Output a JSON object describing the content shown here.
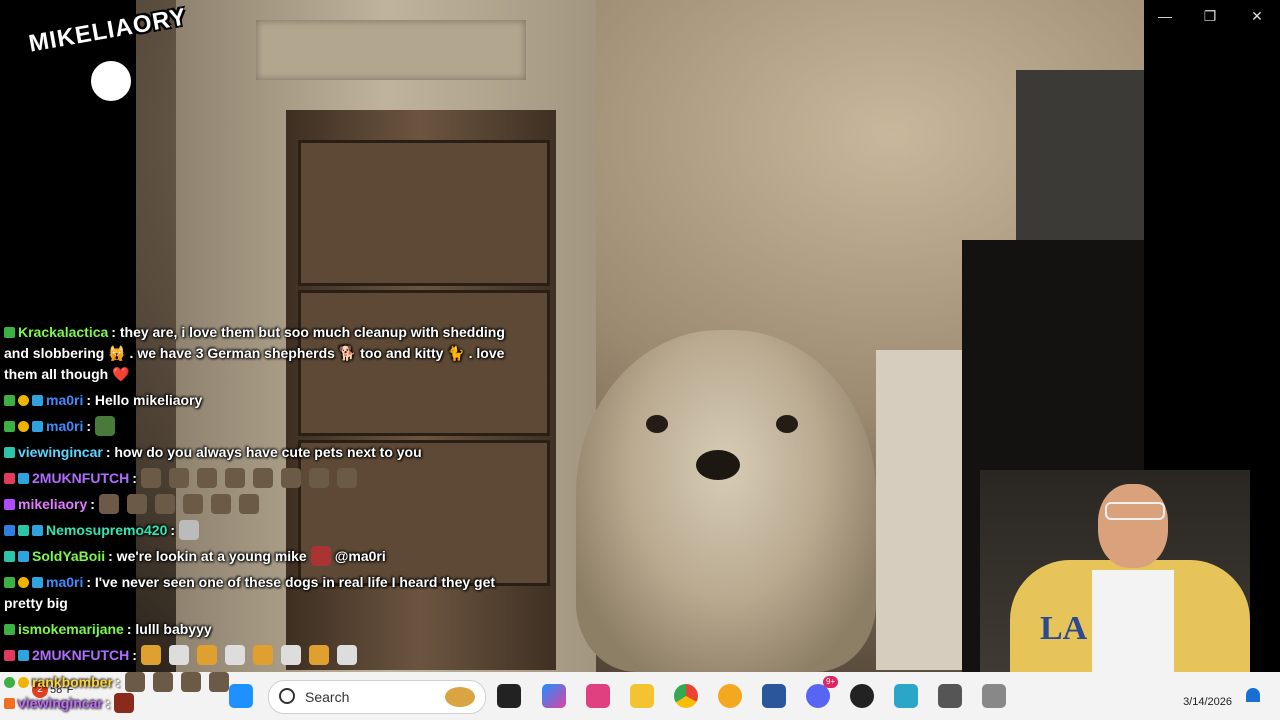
{
  "logo": {
    "text": "MIKELIAORY"
  },
  "window_controls": {
    "minimize": "—",
    "restore": "❐",
    "close": "✕"
  },
  "chat": {
    "messages": [
      {
        "user": "Krackalactica",
        "user_color": "#7cf84a",
        "text": ": they are, i love them but soo much cleanup with shedding and slobbering 🙀 . we have 3 German shepherds 🐕 too and kitty 🐈 . love them all though ❤️"
      },
      {
        "user": "ma0ri",
        "user_color": "#3b8dff",
        "text": ": Hello mikeliaory"
      },
      {
        "user": "ma0ri",
        "user_color": "#3b8dff",
        "text": ":"
      },
      {
        "user": "viewingincar",
        "user_color": "#5fd3ff",
        "text": ": how do you always have cute pets next to you"
      },
      {
        "user": "2MUKNFUTCH",
        "user_color": "#b06cff",
        "text": ":"
      },
      {
        "user": "mikeliaory",
        "user_color": "#e27cff",
        "text": ":"
      },
      {
        "user": "Nemosupremo420",
        "user_color": "#33e6b4",
        "text": ":"
      },
      {
        "user": "SoldYaBoii",
        "user_color": "#7cf84a",
        "text": ": we're lookin at a young mike",
        "tail": "@ma0ri"
      },
      {
        "user": "ma0ri",
        "user_color": "#3b8dff",
        "text": ": I've never seen one of these dogs in real life I heard they get pretty big"
      },
      {
        "user": "ismokemarijane",
        "user_color": "#7cf84a",
        "text": ": lulll babyyy"
      },
      {
        "user": "2MUKNFUTCH",
        "user_color": "#b06cff",
        "text": ":"
      }
    ],
    "low": [
      {
        "user": "rankbomber",
        "user_color": "#ffd23a",
        "text": ":"
      },
      {
        "user": "viewingincar",
        "user_color": "#c06cff",
        "text": ":"
      }
    ]
  },
  "taskbar": {
    "search_label": "Search",
    "weather_temp": "58°F",
    "weather_badge": "2",
    "clock_date": "3/14/2026",
    "discord_badge": "9+",
    "app_icons": [
      "windows-icon",
      "task-view-icon",
      "copilot-icon",
      "pixiv-icon",
      "files-icon",
      "chrome-icon",
      "widgets-icon",
      "word-icon",
      "discord-icon",
      "obs-icon",
      "sheets-icon",
      "srt-icon",
      "tray-icon"
    ]
  }
}
